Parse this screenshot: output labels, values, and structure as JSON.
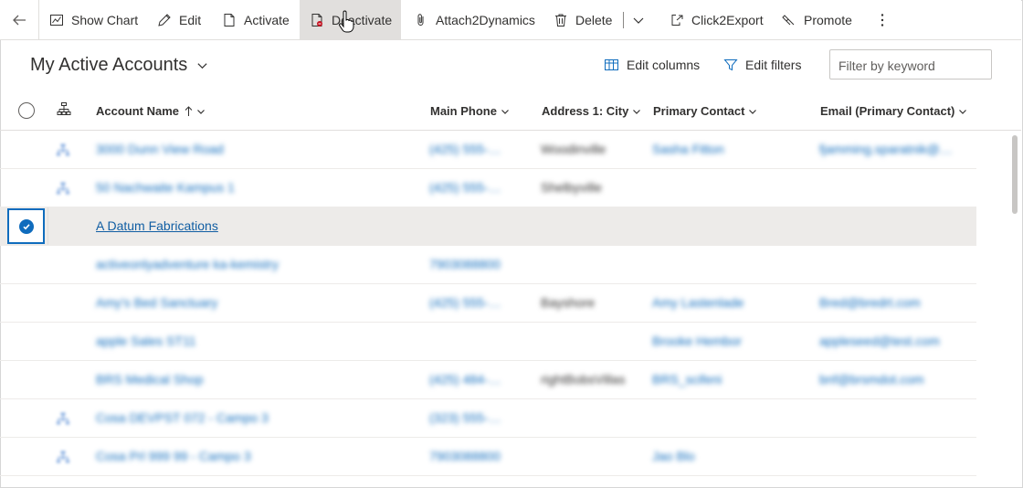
{
  "commands": {
    "show_chart": "Show Chart",
    "edit": "Edit",
    "activate": "Activate",
    "deactivate": "Deactivate",
    "attach2dynamics": "Attach2Dynamics",
    "delete": "Delete",
    "click2export": "Click2Export",
    "promote": "Promote"
  },
  "view": {
    "title": "My Active Accounts",
    "edit_columns": "Edit columns",
    "edit_filters": "Edit filters",
    "filter_placeholder": "Filter by keyword"
  },
  "columns": {
    "account_name": "Account Name",
    "main_phone": "Main Phone",
    "city": "Address 1: City",
    "primary_contact": "Primary Contact",
    "email": "Email (Primary Contact)"
  },
  "rows": [
    {
      "name": "3000 Dunn View Road",
      "phone": "(425) 555-…",
      "city": "Woodinville",
      "contact": "Sasha Fitton",
      "email": "fjamming.sparatnik@…",
      "hier": true
    },
    {
      "name": "50 Nachwaite Kampus 1",
      "phone": "(425) 555-…",
      "city": "Shelbyville",
      "contact": "",
      "email": "",
      "hier": true
    },
    {
      "name": "A Datum Fabrications",
      "phone": "",
      "city": "",
      "contact": "",
      "email": "",
      "hier": false,
      "selected": true
    },
    {
      "name": "activeonlyadventure ka-kemistry",
      "phone": "7903088800",
      "city": "",
      "contact": "",
      "email": "",
      "hier": false
    },
    {
      "name": "Amy's Bed Sanctuary",
      "phone": "(425) 555-…",
      "city": "Bayshore",
      "contact": "Amy Lastenlade",
      "email": "Bred@bredrt.com",
      "hier": false
    },
    {
      "name": "apple Sales ST11",
      "phone": "",
      "city": "",
      "contact": "Brooke Hembor",
      "email": "appleseed@test.com",
      "hier": false
    },
    {
      "name": "BRS Medical Shop",
      "phone": "(425) 484-…",
      "city": "rightBobsVillas",
      "contact": "BRS_scifeni",
      "email": "bnf@brsmdot.com",
      "hier": false
    },
    {
      "name": "Cosa DEVPST 072 - Campo 3",
      "phone": "(323) 555-…",
      "city": "",
      "contact": "",
      "email": "",
      "hier": true
    },
    {
      "name": "Cosa Prl 999 99 - Campo 3",
      "phone": "7903088800",
      "city": "",
      "contact": "Jao Blo",
      "email": "",
      "hier": true
    }
  ]
}
